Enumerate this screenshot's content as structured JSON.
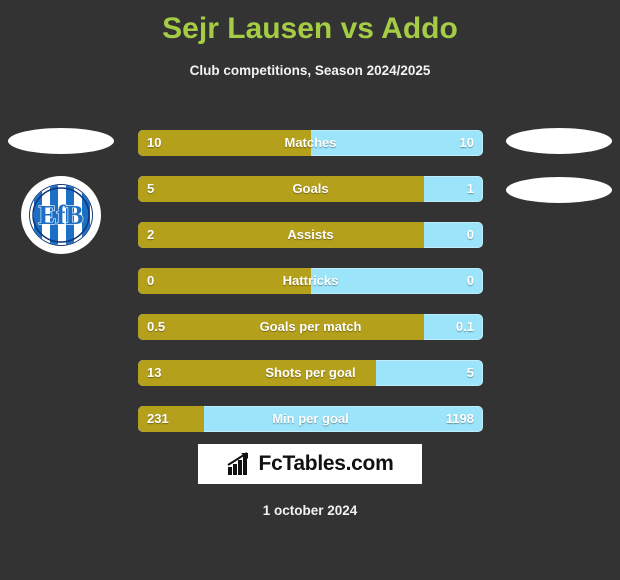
{
  "page": {
    "background_color": "#333333",
    "title": "Sejr Lausen vs Addo",
    "title_color": "#a5cc45",
    "subtitle": "Club competitions, Season 2024/2025",
    "date": "1 october 2024"
  },
  "colors": {
    "home_bar": "#b5a01c",
    "away_bar": "#9be4fa",
    "text": "#ffffff",
    "accent_green": "#a5cc45"
  },
  "crest": {
    "home_team_badge_label": "EfB",
    "badge_colors": {
      "ring": "#c9a227",
      "field": "#1b6fc4",
      "monogram": "#1b6fc4",
      "outline": "#10357a"
    }
  },
  "placeholders": [
    {
      "name": "home-photo-placeholder"
    },
    {
      "name": "away-photo-placeholder-top"
    },
    {
      "name": "away-photo-placeholder-bottom"
    }
  ],
  "logo": {
    "text": "FcTables.com",
    "icon": "bar-chart-icon"
  },
  "chart_data": {
    "type": "bar",
    "title": "Sejr Lausen vs Addo",
    "subtitle": "Club competitions, Season 2024/2025",
    "orientation": "horizontal-diverging",
    "series": [
      {
        "name": "Sejr Lausen",
        "color": "#b5a01c",
        "side": "left"
      },
      {
        "name": "Addo",
        "color": "#9be4fa",
        "side": "right"
      }
    ],
    "categories": [
      "Matches",
      "Goals",
      "Assists",
      "Hattricks",
      "Goals per match",
      "Shots per goal",
      "Min per goal"
    ],
    "rows": [
      {
        "label": "Matches",
        "home": "10",
        "away": "10",
        "home_pct": 50
      },
      {
        "label": "Goals",
        "home": "5",
        "away": "1",
        "home_pct": 83
      },
      {
        "label": "Assists",
        "home": "2",
        "away": "0",
        "home_pct": 83
      },
      {
        "label": "Hattricks",
        "home": "0",
        "away": "0",
        "home_pct": 50
      },
      {
        "label": "Goals per match",
        "home": "0.5",
        "away": "0.1",
        "home_pct": 83
      },
      {
        "label": "Shots per goal",
        "home": "13",
        "away": "5",
        "home_pct": 69
      },
      {
        "label": "Min per goal",
        "home": "231",
        "away": "1198",
        "home_pct": 19
      }
    ],
    "xlabel": "",
    "ylabel": "",
    "grid": false,
    "legend": "none"
  }
}
